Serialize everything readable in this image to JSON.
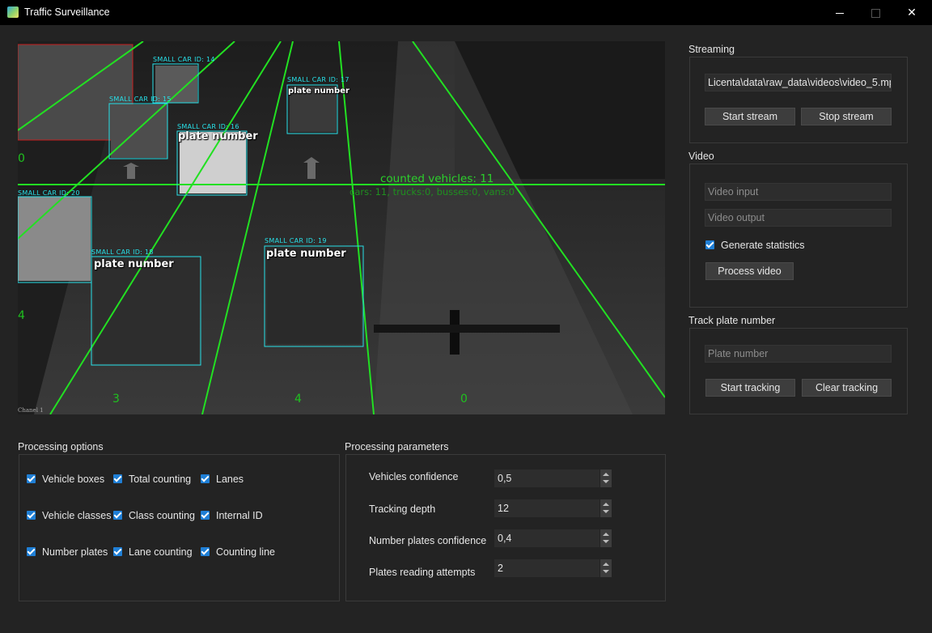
{
  "window": {
    "title": "Traffic Surveillance",
    "icon": "app-icon"
  },
  "video": {
    "overlays": {
      "counted": "counted vehicles: 11",
      "class_counts": "cars: 11, trucks:0, busses:0, vans:0",
      "channel": "Chanel 1",
      "lane_counts": [
        "0",
        "4",
        "3",
        "4",
        "0"
      ]
    },
    "detections": [
      {
        "label": "SMALL CAR ID: 14",
        "plate": ""
      },
      {
        "label": "SMALL CAR ID: 15",
        "plate": ""
      },
      {
        "label": "SMALL CAR ID: 16",
        "plate": "plate number"
      },
      {
        "label": "SMALL CAR ID: 17",
        "plate": "plate number"
      },
      {
        "label": "SMALL CAR ID: 20",
        "plate": ""
      },
      {
        "label": "SMALL CAR ID: 18",
        "plate": "plate number"
      },
      {
        "label": "SMALL CAR ID: 19",
        "plate": "plate number"
      }
    ],
    "colors": {
      "box": "#27e0e8",
      "lane_line": "#22e022",
      "count_line": "#22e022",
      "bus_box": "#c81e1e"
    }
  },
  "streaming": {
    "title": "Streaming",
    "source": "Licenta\\data\\raw_data\\videos\\video_5.mp4",
    "start_label": "Start stream",
    "stop_label": "Stop stream"
  },
  "video_panel": {
    "title": "Video",
    "input_placeholder": "Video input",
    "output_placeholder": "Video output",
    "generate_stats_label": "Generate statistics",
    "generate_stats_checked": true,
    "process_label": "Process video"
  },
  "track": {
    "title": "Track plate number",
    "plate_placeholder": "Plate number",
    "start_label": "Start tracking",
    "clear_label": "Clear tracking"
  },
  "processing_options": {
    "title": "Processing options",
    "options": [
      {
        "label": "Vehicle boxes",
        "checked": true
      },
      {
        "label": "Total counting",
        "checked": true
      },
      {
        "label": "Lanes",
        "checked": true
      },
      {
        "label": "Vehicle classes",
        "checked": true
      },
      {
        "label": "Class counting",
        "checked": true
      },
      {
        "label": "Internal ID",
        "checked": true
      },
      {
        "label": "Number plates",
        "checked": true
      },
      {
        "label": "Lane counting",
        "checked": true
      },
      {
        "label": "Counting line",
        "checked": true
      }
    ]
  },
  "processing_parameters": {
    "title": "Processing parameters",
    "params": [
      {
        "label": "Vehicles confidence",
        "value": "0,5"
      },
      {
        "label": "Tracking depth",
        "value": "12"
      },
      {
        "label": "Number plates confidence",
        "value": "0,4"
      },
      {
        "label": "Plates reading attempts",
        "value": "2"
      }
    ]
  },
  "accent_color": "#1f7fd6"
}
